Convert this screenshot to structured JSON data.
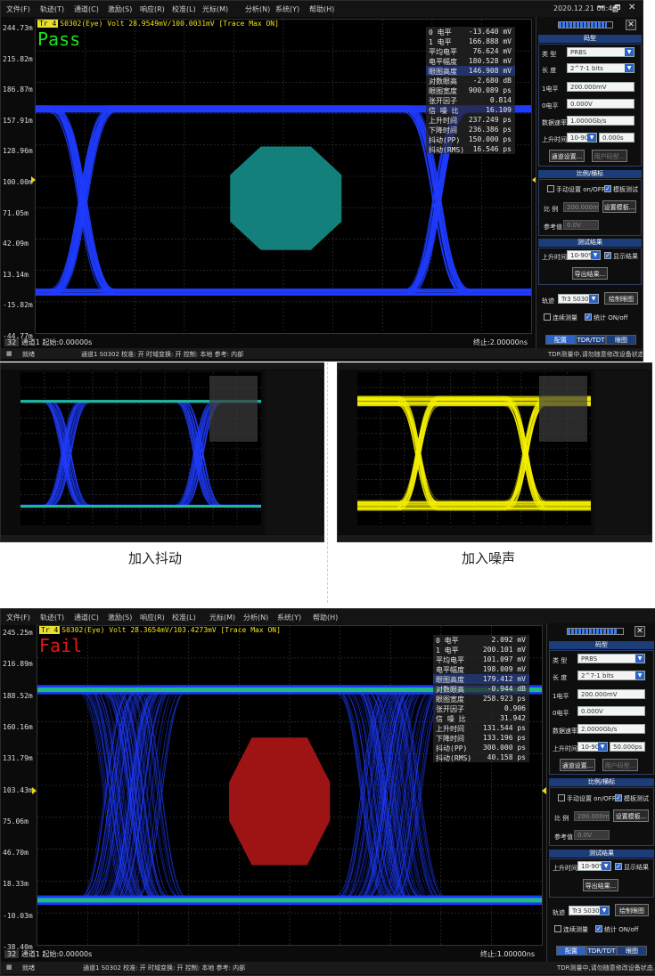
{
  "captions": {
    "left": "加入抖动",
    "right": "加入噪声"
  },
  "menu": [
    "文件(F)",
    "轨迹(T)",
    "通道(C)",
    "激励(S)",
    "响应(R)",
    "校准(L)",
    "光标(M)",
    "分析(N)",
    "系统(Y)",
    "帮助(H)"
  ],
  "window": {
    "minimize": "━",
    "restore": "🗗",
    "close": "✕"
  },
  "sidebar": {
    "panel_close": "✕",
    "code_section": "码型",
    "type_label": "类 型",
    "type_value": "PRBS",
    "length_label": "长 度",
    "length_value": "2^7-1 bits",
    "one_label": "1电平",
    "zero_label": "0电平",
    "rate_label": "数据速率",
    "rise_label": "上升时间",
    "rise_mode": "10-90%",
    "channel_btn": "通道设置...",
    "user_btn": "用户码型...",
    "ratio_section": "比例/横标",
    "manual_label": "手动设置 on/OFF",
    "template_label": "模板测试",
    "ratio_label": "比 例",
    "ratio_value": "200.000mV",
    "template_btn": "设置模板...",
    "ref_label": "参考值",
    "ref_value": "0.0V",
    "results_section": "测试结果",
    "rise_time_label": "上升时间",
    "rise_time_mode": "10-90%",
    "show_result_label": "显示结果",
    "export_btn": "导出结果...",
    "trace_label": "轨迹",
    "trace_value": "Tr3 S0302",
    "draw_btn": "绘制眼图",
    "continuous_label": "连续测量",
    "stats_label": "统计 ON/off",
    "tabs": [
      "配置",
      "TDR/TDT",
      "眼图"
    ]
  },
  "bottom_left": "就绪",
  "bottom_mid": "通道1  S0302  校准: 开  时域变换: 开  控制: 本地  参考: 内部",
  "bottom_right": "TDR测量中,请勿随意修改设备状态.",
  "meas_labels": [
    "0 电平",
    "1 电平",
    "平均电平",
    "电平幅度",
    "眼图高度",
    "对数眼高",
    "眼图宽度",
    "张开因子",
    "信 噪 比",
    "上升时间",
    "下降时间",
    "抖动(PP)",
    "抖动(RMS)"
  ],
  "pass_panel": {
    "datetime": "2020.12.21 08:41",
    "trace_tag": "Tr 4",
    "trace_title": "S0302(Eye) Volt 28.9549mV/100.0031mV  [Trace Max ON]",
    "verdict": "Pass",
    "y_labels": [
      "244.73m",
      "215.82m",
      "186.87m",
      "157.91m",
      "128.96m",
      "100.00m",
      "71.05m",
      "42.09m",
      "13.14m",
      "-15.82m",
      "-44.77m"
    ],
    "ref_y_index": 5,
    "meas_values": [
      "-13.640 mV",
      "166.888 mV",
      "76.624 mV",
      "180.528 mV",
      "146.908 mV",
      "-2.680 dB",
      "900.089 ps",
      "0.814",
      "16.109",
      "237.249 ps",
      "236.386 ps",
      "150.000 ps",
      "16.546 ps"
    ],
    "highlight_row": 4,
    "sidebar_values": {
      "one": "200.000mV",
      "zero": "0.000V",
      "rate": "1.0000Gb/s",
      "rise": "0.000s"
    },
    "status_left_num": "32",
    "status_left": "通道1  起始:0.00000s",
    "status_right": "终止:2.00000ns",
    "progress_pct": 90,
    "mask_color": "#13807c"
  },
  "fail_panel": {
    "trace_tag": "Tr 4",
    "trace_title": "S0302(Eye) Volt 28.3654mV/103.4273mV  [Trace Max ON]",
    "verdict": "Fail",
    "y_labels": [
      "245.25m",
      "216.89m",
      "188.52m",
      "160.16m",
      "131.79m",
      "103.43m",
      "75.06m",
      "46.70m",
      "18.33m",
      "-10.03m",
      "-38.40m"
    ],
    "ref_y_index": 5,
    "meas_values": [
      "2.092 mV",
      "200.101 mV",
      "101.097 mV",
      "198.009 mV",
      "179.412 mV",
      "-0.944 dB",
      "258.923 ps",
      "0.906",
      "31.942",
      "131.544 ps",
      "133.196 ps",
      "300.000 ps",
      "40.158 ps"
    ],
    "highlight_row": 4,
    "sidebar_values": {
      "one": "200.000mV",
      "zero": "0.000V",
      "rate": "2.0000Gb/s",
      "rise": "50.000ps"
    },
    "status_left_num": "32",
    "status_left": "通道1  起始:0.00000s",
    "status_right": "终止:1.00000ns",
    "progress_pct": 90,
    "mask_color": "#9e1414"
  },
  "colors": {
    "grid": "#3a3a3a",
    "eye_blue": "#1f3cff",
    "eye_green": "#1fe85a",
    "eye_yellow": "#f5f000",
    "pass_text": "#19e61c",
    "fail_text": "#e01a1a"
  }
}
